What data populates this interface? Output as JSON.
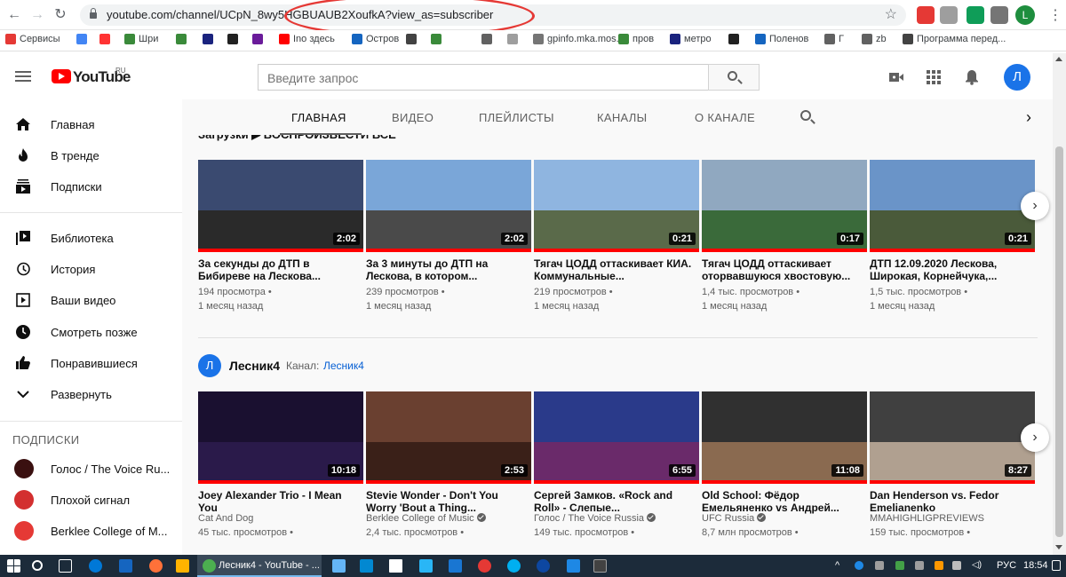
{
  "browser": {
    "url": "youtube.com/channel/UCpN_8wy5HGBUAUB2XoufkA?view_as=subscriber",
    "tab_title": "Лесник4 - YouTube - ...",
    "profile_letter": "L",
    "bookmarks": [
      "Сервисы",
      "Шри",
      "Ino здесь",
      "Остров",
      "gpinfo.mka.mos.ru",
      "пров",
      "метро",
      "Поленов",
      "Г",
      "zb",
      "Программа перед..."
    ]
  },
  "header": {
    "logo_text": "YouTube",
    "logo_region": "RU",
    "search_placeholder": "Введите запрос",
    "avatar_letter": "Л"
  },
  "sidebar": {
    "main": [
      {
        "label": "Главная",
        "icon": "home-icon"
      },
      {
        "label": "В тренде",
        "icon": "fire-icon"
      },
      {
        "label": "Подписки",
        "icon": "subscriptions-icon"
      }
    ],
    "library": [
      {
        "label": "Библиотека",
        "icon": "library-icon"
      },
      {
        "label": "История",
        "icon": "history-icon"
      },
      {
        "label": "Ваши видео",
        "icon": "your-videos-icon"
      },
      {
        "label": "Смотреть позже",
        "icon": "watch-later-icon"
      },
      {
        "label": "Понравившиеся",
        "icon": "like-icon"
      },
      {
        "label": "Развернуть",
        "icon": "chevron-down-icon"
      }
    ],
    "subscriptions_heading": "ПОДПИСКИ",
    "subscriptions": [
      {
        "label": "Голос / The Voice Ru...",
        "color": "#3a1010"
      },
      {
        "label": "Плохой сигнал",
        "color": "#d32f2f"
      },
      {
        "label": "Berklee College of M...",
        "color": "#e53935"
      }
    ]
  },
  "tabs": [
    "ГЛАВНАЯ",
    "ВИДЕО",
    "ПЛЕЙЛИСТЫ",
    "КАНАЛЫ",
    "О КАНАЛЕ"
  ],
  "section1": {
    "title": "Загрузки   ▶  ВОСПРОИЗВЕСТИ ВСЕ",
    "videos": [
      {
        "title": "За секунды до ДТП в Бибиреве на Лескова...",
        "views": "194 просмотра •",
        "age": "1 месяц назад",
        "duration": "2:02",
        "sky": "#3a4a70",
        "ground": "#2a2a2a"
      },
      {
        "title": "За 3 минуты до ДТП на Лескова, в котором...",
        "views": "239 просмотров •",
        "age": "1 месяц назад",
        "duration": "2:02",
        "sky": "#7aa6d8",
        "ground": "#4a4a4a"
      },
      {
        "title": "Тягач ЦОДД оттаскивает КИА. Коммунальные...",
        "views": "219 просмотров •",
        "age": "1 месяц назад",
        "duration": "0:21",
        "sky": "#8fb5e0",
        "ground": "#5a6a4a"
      },
      {
        "title": "Тягач ЦОДД оттаскивает оторвавшуюся хвостовую...",
        "views": "1,4 тыс. просмотров •",
        "age": "1 месяц назад",
        "duration": "0:17",
        "sky": "#90a8c0",
        "ground": "#3a6a3a"
      },
      {
        "title": "ДТП 12.09.2020 Лескова, Широкая, Корнейчука,...",
        "views": "1,5 тыс. просмотров •",
        "age": "1 месяц назад",
        "duration": "0:21",
        "sky": "#6a94c8",
        "ground": "#4a5a3a"
      }
    ]
  },
  "section2": {
    "channel_letter": "Л",
    "channel_name": "Лесник4",
    "channel_label": "Канал:",
    "channel_link": "Лесник4",
    "videos": [
      {
        "title": "Joey Alexander Trio - I Mean You",
        "channel": "Cat And Dog",
        "verified": false,
        "views": "45 тыс. просмотров •",
        "duration": "10:18",
        "sky": "#1a1030",
        "ground": "#2a1a4a"
      },
      {
        "title": "Stevie Wonder - Don't You Worry 'Bout a Thing...",
        "channel": "Berklee College of Music",
        "verified": true,
        "views": "2,4 тыс. просмотров •",
        "duration": "2:53",
        "sky": "#6a4030",
        "ground": "#3a2018"
      },
      {
        "title": "Сергей Замков. «Rock and Roll» - Слепые...",
        "channel": "Голос / The Voice Russia",
        "verified": true,
        "views": "149 тыс. просмотров •",
        "duration": "6:55",
        "sky": "#2a3a8a",
        "ground": "#6a2a6a"
      },
      {
        "title": "Old School: Фёдор Емельяненко vs Андрей...",
        "channel": "UFC Russia",
        "verified": true,
        "views": "8,7 млн просмотров •",
        "duration": "11:08",
        "sky": "#303030",
        "ground": "#8a6a50"
      },
      {
        "title": "Dan Henderson vs. Fedor Emelianenko",
        "channel": "MMAHIGHLIGPREVIEWS",
        "verified": false,
        "views": "159 тыс. просмотров •",
        "duration": "8:27",
        "sky": "#404040",
        "ground": "#b0a090"
      }
    ]
  },
  "taskbar": {
    "lang": "РУС",
    "time": "18:54"
  }
}
